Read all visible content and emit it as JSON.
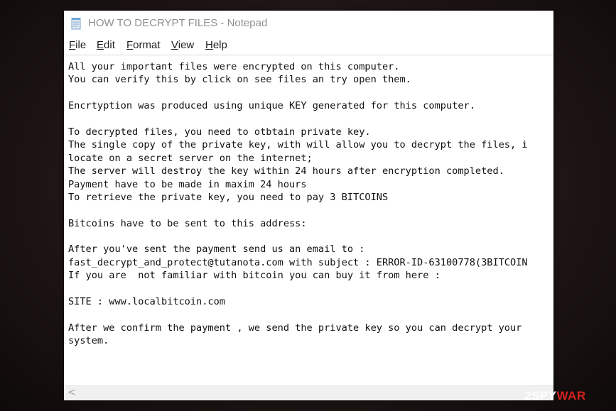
{
  "window": {
    "title": "HOW TO DECRYPT FILES - Notepad"
  },
  "menu": {
    "file": {
      "accel": "F",
      "rest": "ile"
    },
    "edit": {
      "accel": "E",
      "rest": "dit"
    },
    "format": {
      "accel": "F",
      "rest": "ormat"
    },
    "view": {
      "accel": "V",
      "rest": "iew"
    },
    "help": {
      "accel": "H",
      "rest": "elp"
    }
  },
  "note": {
    "lines": [
      "All your important files were encrypted on this computer.",
      "You can verify this by click on see files an try open them.",
      "",
      "Encrtyption was produced using unique KEY generated for this computer.",
      "",
      "To decrypted files, you need to otbtain private key.",
      "The single copy of the private key, with will allow you to decrypt the files, i",
      "locate on a secret server on the internet;",
      "The server will destroy the key within 24 hours after encryption completed.",
      "Payment have to be made in maxim 24 hours",
      "To retrieve the private key, you need to pay 3 BITCOINS",
      "",
      "Bitcoins have to be sent to this address:",
      "",
      "After you've sent the payment send us an email to :",
      "fast_decrypt_and_protect@tutanota.com with subject : ERROR-ID-63100778(3BITCOIN",
      "If you are  not familiar with bitcoin you can buy it from here :",
      "",
      "SITE : www.localbitcoin.com",
      "",
      "After we confirm the payment , we send the private key so you can decrypt your",
      "system."
    ]
  },
  "scrollbar": {
    "left_arrow": "<"
  },
  "watermark": {
    "part1": "2SPY",
    "part2": "WAR"
  },
  "colors": {
    "brand_red": "#d8231f",
    "title_gray": "#8f8f8f"
  },
  "icons": {
    "app": "notepad-icon",
    "scroll_left": "scroll-left-arrow-icon"
  }
}
